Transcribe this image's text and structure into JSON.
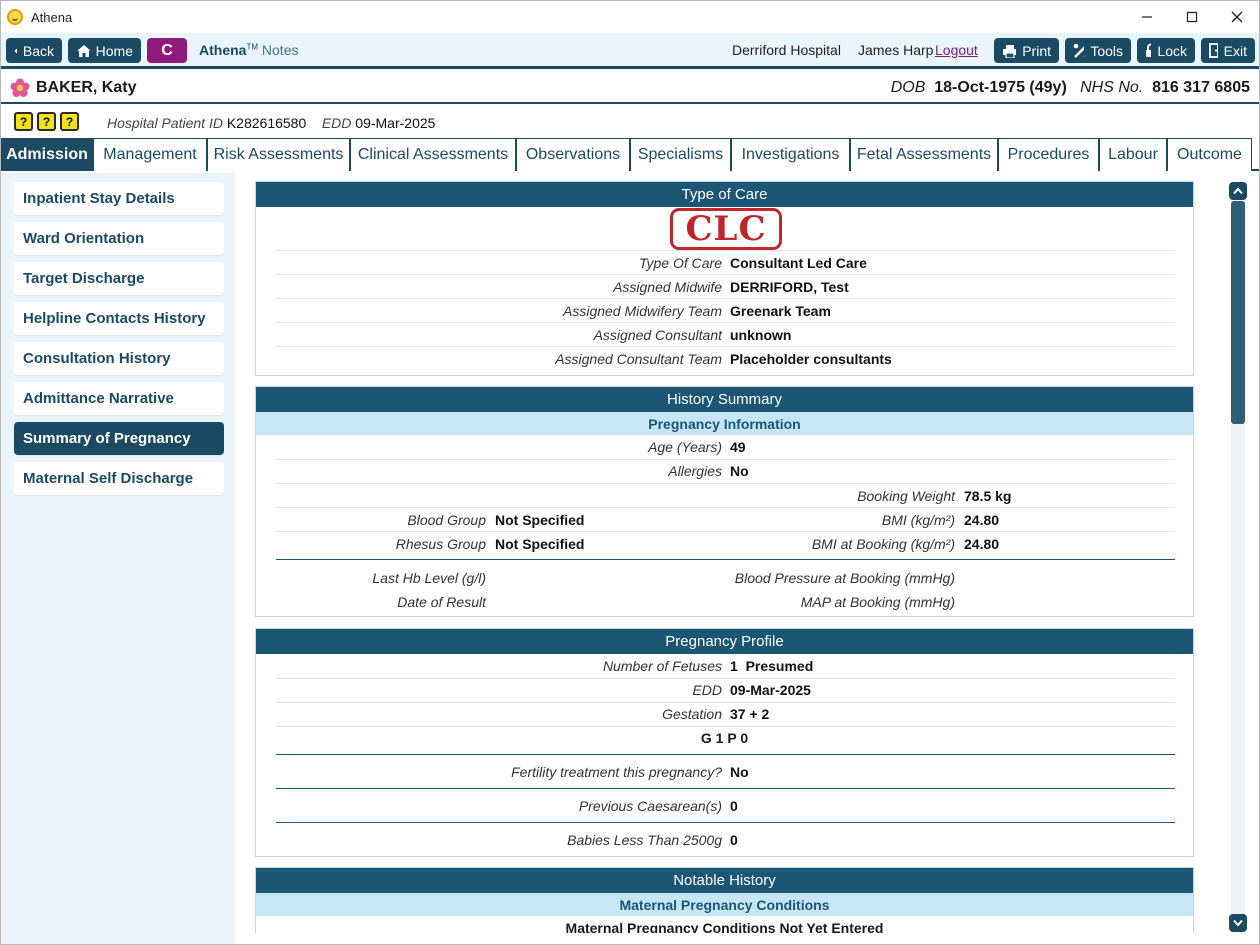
{
  "window": {
    "title": "Athena",
    "minimize": "—",
    "maximize": "☐",
    "close": "✕"
  },
  "toolbar": {
    "back": "Back",
    "home": "Home",
    "c_label": "C",
    "app_name": "Athena",
    "app_tm": "TM",
    "app_notes": "Notes",
    "hospital": "Derriford Hospital",
    "user": "James Harp",
    "logout": "Logout",
    "print": "Print",
    "tools": "Tools",
    "lock": "Lock",
    "exit": "Exit"
  },
  "patient": {
    "name": "BAKER, Katy",
    "dob_label": "DOB",
    "dob": "18-Oct-1975 (49y)",
    "nhs_label": "NHS No.",
    "nhs": "816 317 6805",
    "hpid_label": "Hospital Patient ID",
    "hpid": "K282616580",
    "edd_label": "EDD",
    "edd": "09-Mar-2025",
    "icons": [
      "?",
      "?",
      "?"
    ]
  },
  "tabs": [
    "Admission",
    "Management",
    "Risk Assessments",
    "Clinical Assessments",
    "Observations",
    "Specialisms",
    "Investigations",
    "Fetal Assessments",
    "Procedures",
    "Labour",
    "Outcome"
  ],
  "sidebar": [
    "Inpatient Stay Details",
    "Ward Orientation",
    "Target Discharge",
    "Helpline Contacts History",
    "Consultation History",
    "Admittance Narrative",
    "Summary of Pregnancy",
    "Maternal Self Discharge"
  ],
  "type_of_care": {
    "title": "Type of Care",
    "stamp": "CLC",
    "rows": [
      {
        "label": "Type Of Care",
        "value": "Consultant Led Care"
      },
      {
        "label": "Assigned Midwife",
        "value": "DERRIFORD, Test"
      },
      {
        "label": "Assigned Midwifery Team",
        "value": "Greenark Team"
      },
      {
        "label": "Assigned Consultant",
        "value": "unknown"
      },
      {
        "label": "Assigned Consultant Team",
        "value": "Placeholder consultants"
      }
    ]
  },
  "history_summary": {
    "title": "History Summary",
    "subtitle": "Pregnancy Information",
    "age_label": "Age (Years)",
    "age": "49",
    "allergies_label": "Allergies",
    "allergies": "No",
    "booking_weight_label": "Booking Weight",
    "booking_weight": "78.5 kg",
    "blood_group_label": "Blood Group",
    "blood_group": "Not Specified",
    "bmi_label": "BMI (kg/m²)",
    "bmi": "24.80",
    "rhesus_label": "Rhesus Group",
    "rhesus": "Not Specified",
    "bmi_booking_label": "BMI at Booking (kg/m²)",
    "bmi_booking": "24.80",
    "hb_label": "Last Hb Level (g/l)",
    "bp_label": "Blood Pressure at Booking (mmHg)",
    "date_result_label": "Date of Result",
    "map_label": "MAP at Booking (mmHg)"
  },
  "pregnancy_profile": {
    "title": "Pregnancy Profile",
    "fetuses_label": "Number of Fetuses",
    "fetuses": "1",
    "fetuses_note": "Presumed",
    "edd_label": "EDD",
    "edd": "09-Mar-2025",
    "gestation_label": "Gestation",
    "gestation": "37 + 2",
    "gp": "G 1 P 0",
    "fertility_label": "Fertility treatment this pregnancy?",
    "fertility": "No",
    "caesarean_label": "Previous Caesarean(s)",
    "caesarean": "0",
    "babies_label": "Babies Less Than 2500g",
    "babies": "0"
  },
  "notable_history": {
    "title": "Notable History",
    "subtitle": "Maternal Pregnancy Conditions",
    "note": "Maternal Pregnancy Conditions Not Yet Entered"
  },
  "colors": {
    "primary": "#1b4a63",
    "header": "#1b5674",
    "subheader": "#c6e6f6",
    "accent": "#8f1c7a",
    "stamp": "#c0262b",
    "sidebar_bg": "#e9f5fb"
  }
}
